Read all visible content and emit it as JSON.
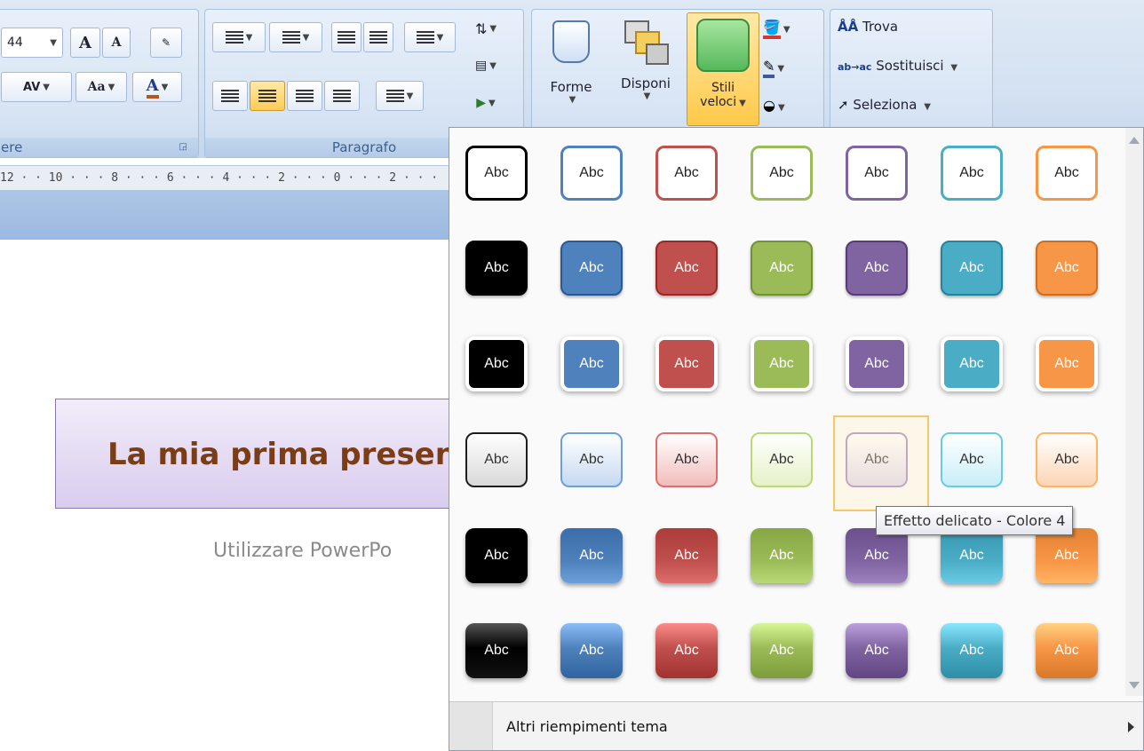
{
  "ribbon": {
    "font": {
      "size_value": "44",
      "grow_label": "A",
      "shrink_label": "A",
      "spacing_label": "AV",
      "case_label": "Aa",
      "color_label": "A",
      "group_label": "ere"
    },
    "paragraph": {
      "group_label": "Paragrafo"
    },
    "drawing": {
      "shapes_label": "Forme",
      "arrange_label": "Disponi",
      "quick_styles_label_1": "Stili",
      "quick_styles_label_2": "veloci"
    },
    "editing": {
      "find_label": "Trova",
      "replace_label": "Sostituisci",
      "select_label": "Seleziona"
    }
  },
  "ruler": {
    "text": "12 · · 10 · · · 8 · · · 6 · · · 4 · · · 2 · · · 0 · · · 2 · · ·"
  },
  "slide": {
    "title": "La mia prima presen",
    "subtitle": "Utilizzare PowerPo"
  },
  "gallery": {
    "cell_label": "Abc",
    "hover_tooltip": "Effetto delicato - Colore 4",
    "footer_label": "Altri riempimenti tema",
    "colors": [
      "#000000",
      "#4f81bd",
      "#c0504d",
      "#9bbb59",
      "#8064a2",
      "#4bacc6",
      "#f79646"
    ],
    "light_colors": [
      "#d9d9d9",
      "#c6d9f1",
      "#f2bcbc",
      "#e6f2c8",
      "#ddd4ee",
      "#c9eef7",
      "#fcd5b5"
    ]
  }
}
